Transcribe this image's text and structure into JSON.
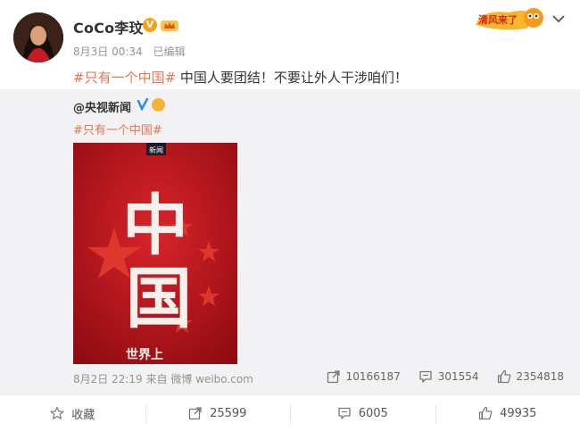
{
  "post": {
    "username": "CoCo李玟",
    "v_badge": "V",
    "timestamp": "8月3日 00:34",
    "edited": "已编辑",
    "hashtag": "#只有一个中国#",
    "body_text": "中国人要团结！不要让外人干涉咱们！"
  },
  "repost": {
    "source_name": "@央视新闻",
    "hashtag": "#只有一个中国#",
    "poster": {
      "logo_text": "新闻",
      "title": "中国",
      "caption": "世界上"
    },
    "timestamp": "8月2日 22:19",
    "source_label": "来自 微博 weibo.com",
    "stats": {
      "reposts": "10166187",
      "comments": "301554",
      "likes": "2354818"
    }
  },
  "actions": {
    "favorite": "收藏",
    "repost": "25599",
    "comment": "6005",
    "like": "49935"
  },
  "colors": {
    "hashtag": "#eb7350",
    "repost_bg": "#f2f2f5",
    "poster_red": "#c8151c",
    "badge_orange": "#f7a21a"
  }
}
